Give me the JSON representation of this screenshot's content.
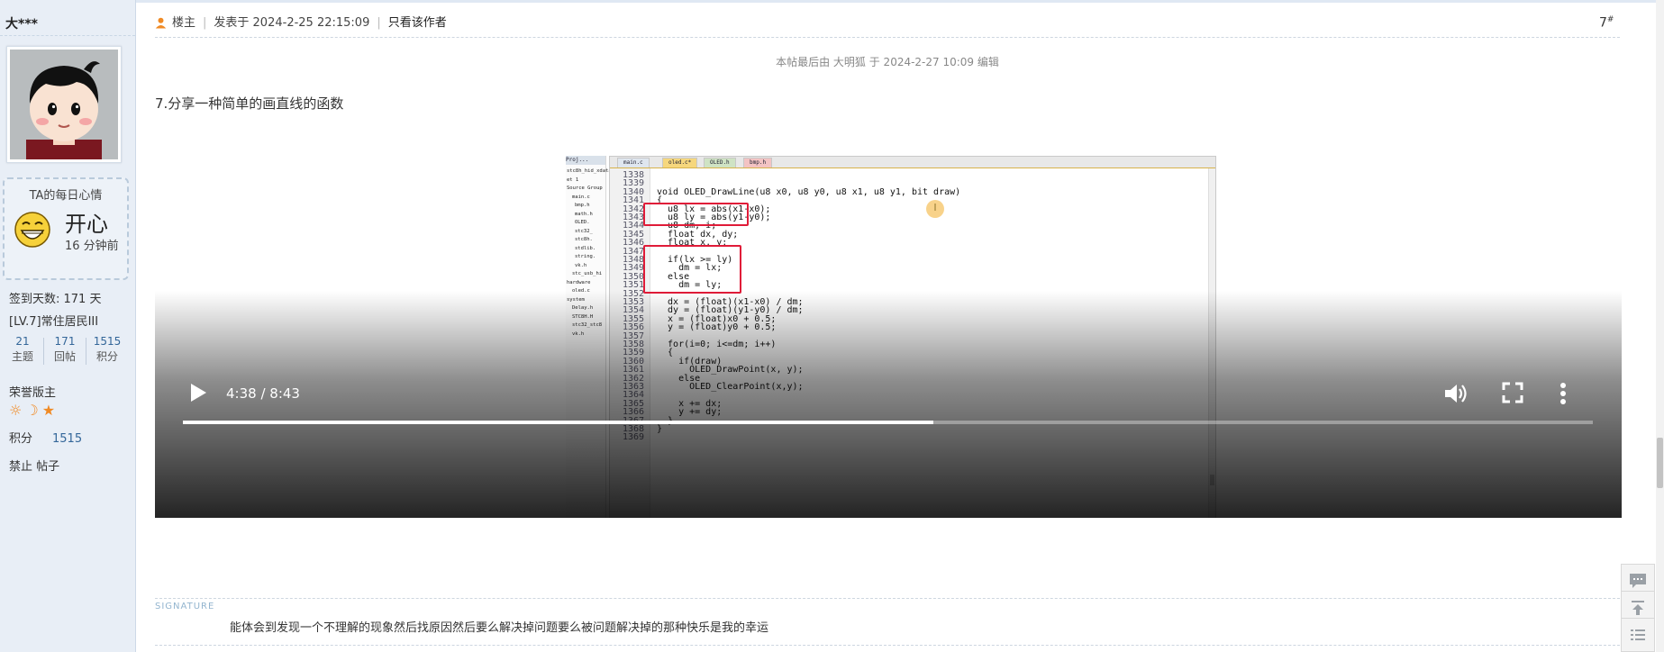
{
  "author": {
    "name": "大***",
    "mood": {
      "title": "TA的每日心情",
      "text": "开心",
      "time": "16 分钟前"
    },
    "sign_days": "签到天数: 171 天",
    "level": "[LV.7]常住居民III",
    "stats": [
      {
        "value": "21",
        "label": "主题"
      },
      {
        "value": "171",
        "label": "回帖"
      },
      {
        "value": "1515",
        "label": "积分"
      }
    ],
    "honor": "荣誉版主",
    "score_label": "积分",
    "score_value": "1515",
    "ban": "禁止 帖子"
  },
  "post": {
    "op_label": "楼主",
    "posted_at": "发表于 2024-2-25 22:15:09",
    "only_author": "只看该作者",
    "floor": "7",
    "floor_sup": "#",
    "edit_note": "本帖最后由 大明狐 于 2024-2-27 10:09 编辑",
    "title": "7.分享一种简单的画直线的函数"
  },
  "video": {
    "time": "4:38 / 8:43",
    "progress": 0.532,
    "ide": {
      "project_header": "Proj...",
      "project_items": [
        "stc8h_hid_xdata",
        "et 1",
        "Source Group",
        "main.c",
        "bmp.h",
        "math.h",
        "OLED.",
        "stc32_",
        "stc8h.",
        "stdlib.",
        "string.",
        "vk.h",
        "stc_usb_hi",
        "hardware",
        "oled.c",
        "system",
        "Delay.h",
        "STC8H.H",
        "stc32_stc8",
        "vk.h"
      ],
      "tabs": [
        "main.c",
        "oled.c*",
        "OLED.h",
        "bmp.h"
      ],
      "line_numbers": [
        "1338",
        "1339",
        "1340",
        "1341",
        "1342",
        "1343",
        "1344",
        "1345",
        "1346",
        "1347",
        "1348",
        "1349",
        "1350",
        "1351",
        "1352",
        "1353",
        "1354",
        "1355",
        "1356",
        "1357",
        "1358",
        "1359",
        "1360",
        "1361",
        "1362",
        "1363",
        "1364",
        "1365",
        "1366",
        "1367",
        "1368",
        "1369"
      ],
      "code": [
        "",
        "",
        "void OLED_DrawLine(u8 x0, u8 y0, u8 x1, u8 y1, bit draw)",
        "{",
        "  u8 lx = abs(x1-x0);",
        "  u8 ly = abs(y1-y0);",
        "  u8 dm, i;",
        "  float dx, dy;",
        "  float x, y;",
        "",
        "  if(lx >= ly)",
        "    dm = lx;",
        "  else",
        "    dm = ly;",
        "",
        "  dx = (float)(x1-x0) / dm;",
        "  dy = (float)(y1-y0) / dm;",
        "  x = (float)x0 + 0.5;",
        "  y = (float)y0 + 0.5;",
        "",
        "  for(i=0; i<=dm; i++)",
        "  {",
        "    if(draw)",
        "      OLED_DrawPoint(x, y);",
        "    else",
        "      OLED_ClearPoint(x,y);",
        "",
        "    x += dx;",
        "    y += dy;",
        "  }",
        "}",
        ""
      ]
    }
  },
  "signature": {
    "label": "SIGNATURE",
    "text": "能体会到发现一个不理解的现象然后找原因然后要么解决掉问题要么被问题解决掉的那种快乐是我的幸运"
  },
  "colors": {
    "sidebar_bg": "#e8eef6",
    "accent_orange": "#f08a24",
    "link_blue": "#336699",
    "highlight_red": "#e01b38"
  },
  "icons": {
    "op": "user-icon",
    "play": "play-icon",
    "volume": "volume-icon",
    "fullscreen": "fullscreen-icon",
    "more": "more-vert-icon",
    "reply": "comment-icon",
    "top": "back-to-top-icon",
    "list": "list-icon"
  }
}
